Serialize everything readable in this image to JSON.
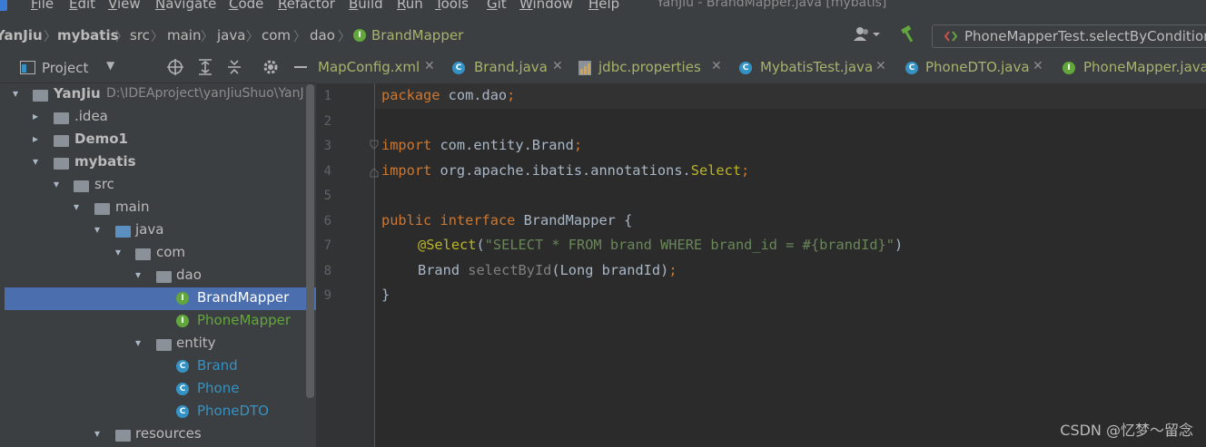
{
  "menubar": {
    "items": [
      "File",
      "Edit",
      "View",
      "Navigate",
      "Code",
      "Refactor",
      "Build",
      "Run",
      "Tools",
      "Git",
      "Window",
      "Help"
    ],
    "window_title": "YanJiu - BrandMapper.java [mybatis]"
  },
  "navbar": {
    "breadcrumbs": [
      "YanJiu",
      "mybatis",
      "src",
      "main",
      "java",
      "com",
      "dao",
      "BrandMapper"
    ],
    "run_config": "PhoneMapperTest.selectByCondition"
  },
  "project": {
    "title": "Project",
    "tree": [
      {
        "label": "YanJiu",
        "path": "D:\\IDEAproject\\yanJiuShuo\\YanJ",
        "bold": true,
        "arrow": "down",
        "icon": "module"
      },
      {
        "label": ".idea",
        "arrow": "right",
        "icon": "folder"
      },
      {
        "label": "Demo1",
        "bold": true,
        "arrow": "right",
        "icon": "module"
      },
      {
        "label": "mybatis",
        "bold": true,
        "arrow": "down",
        "icon": "module"
      },
      {
        "label": "src",
        "arrow": "down",
        "icon": "folder"
      },
      {
        "label": "main",
        "arrow": "down",
        "icon": "folder"
      },
      {
        "label": "java",
        "arrow": "down",
        "icon": "source-folder"
      },
      {
        "label": "com",
        "arrow": "down",
        "icon": "package"
      },
      {
        "label": "dao",
        "arrow": "down",
        "icon": "package"
      },
      {
        "label": "BrandMapper",
        "icon": "interface",
        "selected": true
      },
      {
        "label": "PhoneMapper",
        "icon": "interface"
      },
      {
        "label": "entity",
        "arrow": "down",
        "icon": "package"
      },
      {
        "label": "Brand",
        "icon": "class"
      },
      {
        "label": "Phone",
        "icon": "class"
      },
      {
        "label": "PhoneDTO",
        "icon": "class"
      },
      {
        "label": "resources",
        "arrow": "down",
        "icon": "resources-folder"
      }
    ]
  },
  "tabs": [
    {
      "label": "MapConfig.xml",
      "icon": "xml-icon"
    },
    {
      "label": "Brand.java",
      "icon": "class"
    },
    {
      "label": "jdbc.properties",
      "icon": "properties-icon"
    },
    {
      "label": "MybatisTest.java",
      "icon": "class"
    },
    {
      "label": "PhoneDTO.java",
      "icon": "class"
    },
    {
      "label": "PhoneMapper.java",
      "icon": "interface"
    }
  ],
  "code": {
    "line_numbers": [
      "1",
      "2",
      "3",
      "4",
      "5",
      "6",
      "7",
      "8",
      "9"
    ],
    "l1_kw": "package",
    "l1_rest": " com.dao",
    "semi": ";",
    "l3_kw": "import",
    "l3_rest": " com.entity.Brand",
    "l4_kw": "import",
    "l4_rest": " org.apache.ibatis.annotations.",
    "l4_ann": "Select",
    "l6_kw1": "public",
    "l6_kw2": "interface",
    "l6_rest": " BrandMapper {",
    "l7_ann": "@Select",
    "l7_open": "(",
    "l7_str": "\"SELECT * FROM brand WHERE brand_id = #{brandId}\"",
    "l7_close": ")",
    "l8_type": "Brand ",
    "l8_method": "selectById",
    "l8_args": "(Long brandId)",
    "l9": "}"
  },
  "watermark": "CSDN @忆梦～留念",
  "colors": {
    "selection": "#4b6eaf",
    "interface": "#62a73b",
    "class": "#3592c4",
    "folder": "#8a9199",
    "source_folder": "#5b8fbf",
    "tab_active_underline": "#4a88c7"
  }
}
